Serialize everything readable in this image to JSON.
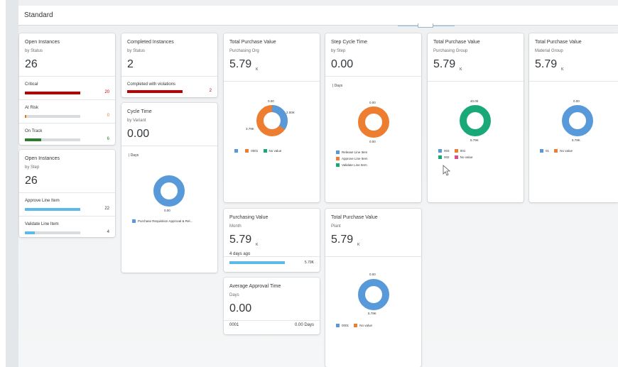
{
  "header": {
    "title": "Standard"
  },
  "colors": {
    "red": "#bb0000",
    "orange": "#e9730c",
    "green": "#2b7d2b",
    "blue": "#5899da",
    "teal": "#19a979",
    "pink": "#e8743b",
    "light_blue": "#5cbae6",
    "donut_orange": "#ed7d31"
  },
  "cards": {
    "open_status": {
      "title": "Open Instances",
      "subtitle": "by Status",
      "value": "26",
      "rows": [
        {
          "label": "Critical",
          "value": "20",
          "fill": 0.85
        },
        {
          "label": "At Risk",
          "value": "0",
          "fill": 0.02
        },
        {
          "label": "On Track",
          "value": "6",
          "fill": 0.28
        }
      ]
    },
    "completed": {
      "title": "Completed Instances",
      "subtitle": "by Status",
      "value": "2",
      "rows": [
        {
          "label": "Completed with violations",
          "value": "2",
          "fill": 0.9
        }
      ]
    },
    "open_step": {
      "title": "Open Instances",
      "subtitle": "by Step",
      "value": "26",
      "rows": [
        {
          "label": "Approve Line Item",
          "value": "22",
          "fill": 0.85
        },
        {
          "label": "Validate Line Item",
          "value": "4",
          "fill": 0.18
        }
      ]
    },
    "cycle_time": {
      "title": "Cycle Time",
      "subtitle": "by Variant",
      "value": "0.00",
      "unit": "| Days",
      "donut_label": "0.00",
      "legend": [
        "Purchase Requisition Approval & Rel..."
      ]
    },
    "tpv_org": {
      "title": "Total Purchase Value",
      "subtitle": "Purchasing Org",
      "value": "5.79",
      "scale": "K",
      "labels": {
        "top": "0.00",
        "right": "2.00K",
        "left": "3.79K"
      },
      "legend": [
        "",
        "0001",
        "No value"
      ]
    },
    "step_cycle": {
      "title": "Step Cycle Time",
      "subtitle": "by Step",
      "value": "0.00",
      "unit": "| Days",
      "labels": {
        "top": "0.00",
        "bottom": "0.00"
      },
      "legend": [
        "Release Line Item",
        "Approve Line Item",
        "Validate Line Item"
      ]
    },
    "tpv_group": {
      "title": "Total Purchase Value",
      "subtitle": "Purchasing Group",
      "value": "5.79",
      "scale": "K",
      "labels": {
        "top": "40.00",
        "bottom": "5.79K"
      },
      "legend": [
        "003",
        "001",
        "002",
        "No value"
      ]
    },
    "tpv_material": {
      "title": "Total Purchase Value",
      "subtitle": "Material Group",
      "value": "5.79",
      "scale": "K",
      "labels": {
        "top": "0.00",
        "bottom": "5.79K"
      },
      "legend": [
        "01",
        "No value"
      ]
    },
    "purchasing_value": {
      "title": "Purchasing Value",
      "subtitle": "Month",
      "value": "5.79",
      "scale": "K",
      "row_label": "4 days ago",
      "row_value": "5.79K",
      "fill": 0.75
    },
    "tpv_plant": {
      "title": "Total Purchase Value",
      "subtitle": "Plant",
      "value": "5.79",
      "scale": "K",
      "labels": {
        "top": "0.00",
        "bottom": "5.79K"
      },
      "legend": [
        "0001",
        "No value"
      ]
    },
    "avg_approval": {
      "title": "Average Approval Time",
      "subtitle": "Days",
      "value": "0.00",
      "row_label": "0001",
      "row_value": "0.00 Days"
    }
  }
}
